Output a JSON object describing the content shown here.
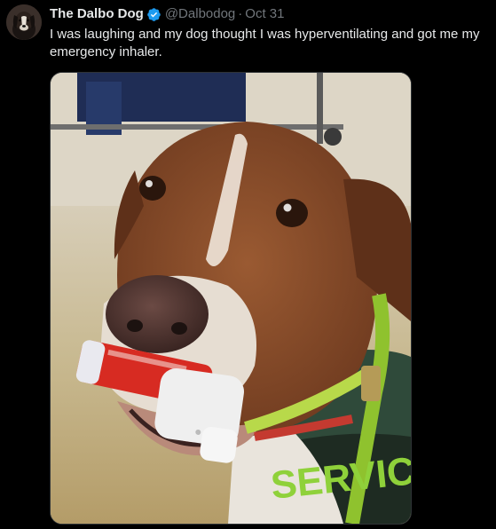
{
  "tweet": {
    "display_name": "The Dalbo Dog",
    "verified": true,
    "handle": "@Dalbodog",
    "separator": "·",
    "time": "Oct 31",
    "text": "I was laughing and my dog thought I was hyperventilating and got me my emergency inhaler."
  },
  "media": {
    "vest_text": "SERVICE"
  },
  "icons": {
    "verified": "verified-badge-icon",
    "avatar": "dog-avatar"
  },
  "colors": {
    "background": "#000000",
    "text_primary": "#e7e9ea",
    "text_secondary": "#71767b",
    "verified_blue": "#1d9bf0",
    "media_border": "#2f3336"
  }
}
